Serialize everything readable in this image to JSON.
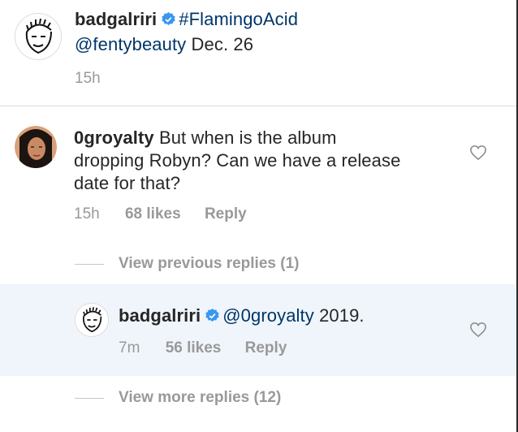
{
  "caption": {
    "username": "badgalriri",
    "hashtag": "#FlamingoAcid",
    "mention": "@fentybeauty",
    "date_text": "Dec. 26",
    "time": "15h"
  },
  "comment": {
    "username": "0groyalty",
    "text_line1": "But when is the album",
    "text_line2": "dropping Robyn? Can we have a release",
    "text_line3": "date for that?",
    "time": "15h",
    "likes": "68 likes",
    "reply_label": "Reply"
  },
  "view_previous": "View previous replies (1)",
  "reply": {
    "username": "badgalriri",
    "mention": "@0groyalty",
    "text": "2019.",
    "time": "7m",
    "likes": "56 likes",
    "reply_label": "Reply"
  },
  "view_more": "View more replies (12)",
  "colors": {
    "link": "#003569",
    "verified": "#3897f0",
    "secondary_text": "#999999",
    "highlight_bg": "#eff5fb"
  },
  "icons": {
    "verified": "verified-badge-icon",
    "like": "heart-icon"
  }
}
